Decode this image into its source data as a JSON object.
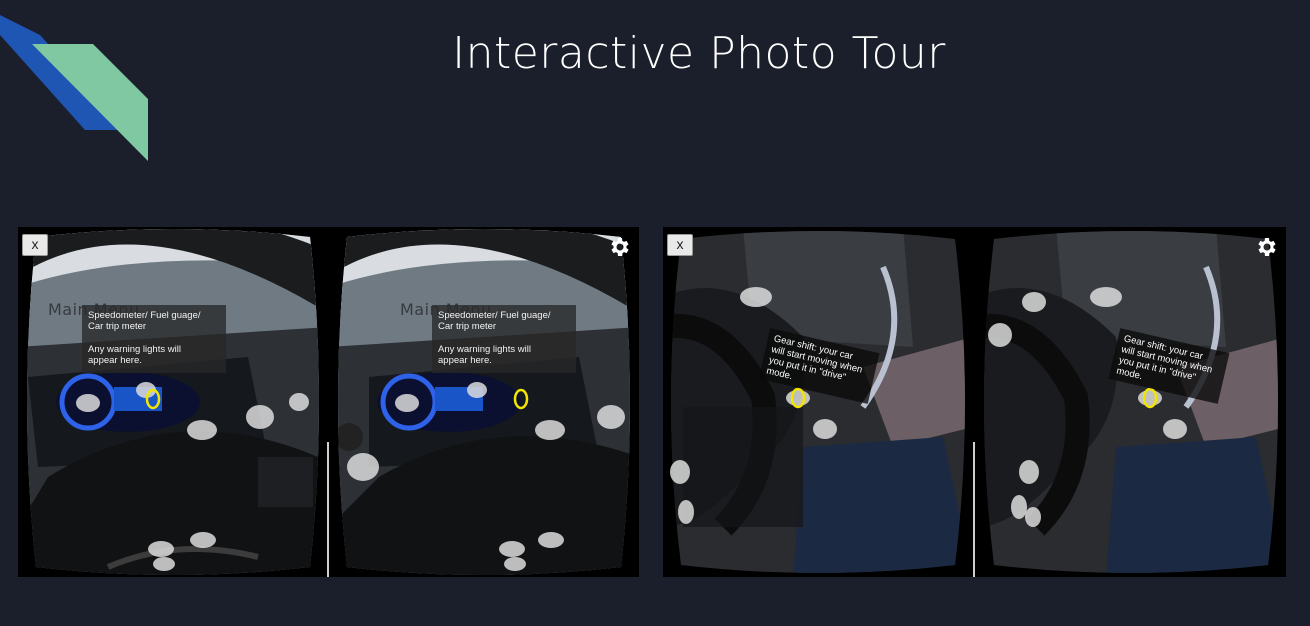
{
  "page": {
    "title": "Interactive Photo Tour"
  },
  "colors": {
    "background": "#1b1f2b",
    "logo_blue": "#1f55b3",
    "logo_green": "#7fc8a2",
    "reticle": "#f2e600"
  },
  "tours": [
    {
      "close_label": "x",
      "settings_icon": "gear-icon",
      "menu_ghost": "Main Menu",
      "info_line1": "Speedometer/ Fuel guage/",
      "info_line2": "Car trip meter",
      "info_line3": "Any warning lights will",
      "info_line4": "appear here."
    },
    {
      "close_label": "x",
      "settings_icon": "gear-icon",
      "info_line1": "Gear shift: your car",
      "info_line2": "will start moving when",
      "info_line3": "you put it in \"drive\"",
      "info_line4": "mode."
    }
  ]
}
